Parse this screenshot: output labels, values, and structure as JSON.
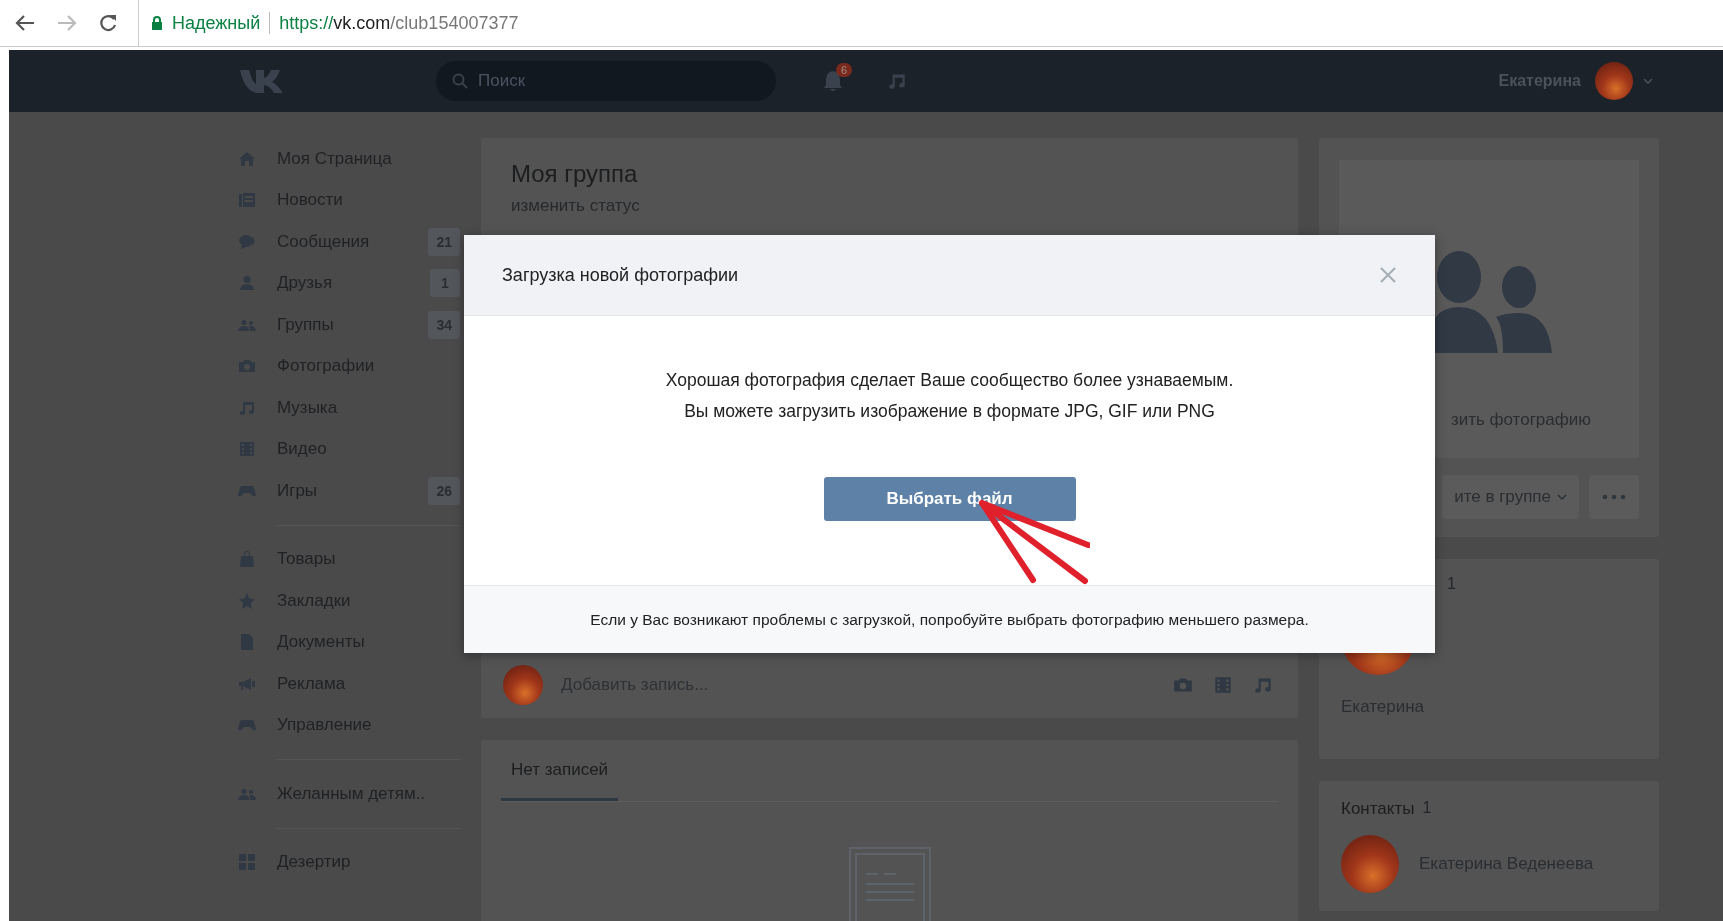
{
  "browser": {
    "security_label": "Надежный",
    "url": {
      "scheme": "https://",
      "host": "vk.com",
      "path": "/club154007377"
    }
  },
  "header": {
    "search": {
      "placeholder": "Поиск"
    },
    "notifications_badge": "6",
    "user_name": "Екатерина"
  },
  "sidebar": {
    "groups": [
      {
        "items": [
          {
            "label": "Моя Страница"
          },
          {
            "label": "Новости"
          },
          {
            "label": "Сообщения",
            "counter": "21"
          },
          {
            "label": "Друзья",
            "counter": "1"
          },
          {
            "label": "Группы",
            "counter": "34"
          },
          {
            "label": "Фотографии"
          },
          {
            "label": "Музыка"
          },
          {
            "label": "Видео"
          },
          {
            "label": "Игры",
            "counter": "26"
          }
        ]
      },
      {
        "items": [
          {
            "label": "Товары"
          },
          {
            "label": "Закладки"
          },
          {
            "label": "Документы"
          },
          {
            "label": "Реклама"
          },
          {
            "label": "Управление"
          }
        ]
      },
      {
        "items": [
          {
            "label": "Желанным детям.."
          }
        ]
      },
      {
        "items": [
          {
            "label": "Дезертир"
          }
        ]
      }
    ]
  },
  "group_page": {
    "title": "Моя группа",
    "status_link": "изменить статус",
    "composer": {
      "placeholder": "Добавить запись..."
    },
    "wall_tabs": [
      {
        "label": "Нет записей",
        "selected": true
      }
    ],
    "cover": {
      "upload_link": "зить фотографию"
    },
    "membership_button": "ите в группе",
    "members": {
      "count": "1",
      "name": "Екатерина"
    },
    "contacts": {
      "title": "Контакты",
      "count": "1",
      "items": [
        {
          "name": "Екатерина Веденеева"
        }
      ]
    }
  },
  "modal": {
    "title": "Загрузка новой фотографии",
    "message_lines": [
      "Хорошая фотография сделает Ваше сообщество более узнаваемым.",
      "Вы можете загрузить изображение в формате JPG, GIF или PNG"
    ],
    "primary_button": "Выбрать файл",
    "footer_note": "Если у Вас возникают проблемы с загрузкой, попробуйте выбрать фотографию меньшего размера."
  }
}
